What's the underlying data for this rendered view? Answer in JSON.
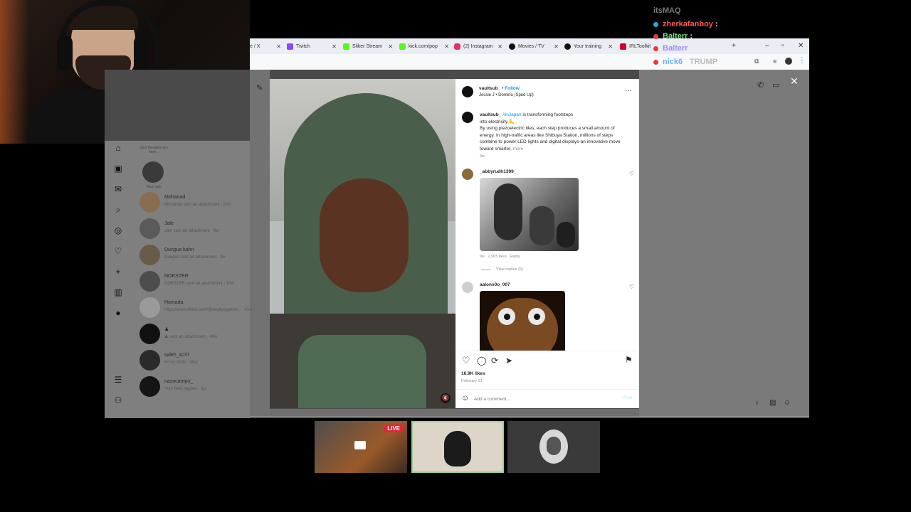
{
  "chat": [
    {
      "user": "itsMAQ",
      "color": "#7b7b7b"
    },
    {
      "user": "zherkafanboy",
      "color": "#ff5a5a"
    },
    {
      "user": "Balterr",
      "color": "#6fe07a"
    },
    {
      "user": "Balterr",
      "color": "#9d8cff"
    },
    {
      "user": "nick6",
      "color": "#6ab0ff",
      "message": "TRUMP"
    }
  ],
  "tabs": [
    {
      "label": "e / X",
      "icon_color": "#000000"
    },
    {
      "label": "Twitch",
      "icon_color": "#9146ff"
    },
    {
      "label": "Sliker Stream",
      "icon_color": "#53fc18"
    },
    {
      "label": "kick.com/pop",
      "icon_color": "#53fc18"
    },
    {
      "label": "(2) Instagram",
      "icon_color": "#e1306c"
    },
    {
      "label": "Movies / TV",
      "icon_color": "#111111"
    },
    {
      "label": "Your training",
      "icon_color": "#111111"
    },
    {
      "label": "IRLToolkit",
      "icon_color": "#d00030"
    }
  ],
  "window_controls": {
    "new_tab": "+",
    "minimize": "–",
    "maximize": "▫",
    "close": "✕"
  },
  "sidebar": {
    "nav_icons": [
      "home-icon",
      "reels-icon",
      "messages-icon",
      "search-icon",
      "explore-icon",
      "notifications-icon",
      "create-icon",
      "dashboard-icon",
      "profile-icon",
      "menu-icon",
      "more-icon"
    ],
    "your_note": {
      "title": "Your thoughts are here...",
      "label": "Your note"
    },
    "dms": [
      {
        "name": "Mohanad",
        "sub": "Mohanad sent an attachment · 20h"
      },
      {
        "name": "Jale",
        "sub": "Jale sent an attachment · 9w"
      },
      {
        "name": "Dungus kahn",
        "sub": "Dungus sent an attachment · 9w"
      },
      {
        "name": "NOKSTER",
        "sub": "NOKSTER sent an attachment · 10w"
      },
      {
        "name": "Hamada",
        "sub": "https://www.tiktok.com/@soullysgamer... · 41w"
      },
      {
        "name": "♟",
        "sub": "♟ sent an attachment · 46w"
      },
      {
        "name": "saleh_sc37",
        "sub": "Hi my bride · 48w"
      },
      {
        "name": "nazocampo_",
        "sub": "Your best regions · 1y"
      }
    ]
  },
  "post": {
    "username": "vaultsub_",
    "follow": "Follow",
    "audio": "Jessie J • Domino (Sped Up)",
    "caption_tag": "#inJapan",
    "caption_line1": "is transforming footsteps",
    "caption_line2": "into electricity 🦶",
    "caption_body": "By using piezoelectric tiles, each step produces a small amount of energy. In high-traffic areas like Shibuya Station, millions of steps combine to power LED lights and digital displays-an innovative move toward smarter,",
    "more": "more",
    "caption_time": "9w",
    "comments": [
      {
        "user": "_abbyrudh1399_",
        "time": "9w",
        "likes": "2,905 likes",
        "reply": "Reply",
        "view_replies": "View replies (5)"
      },
      {
        "user": "aalons0o_007"
      }
    ],
    "likes": "16.9K likes",
    "date": "February 21",
    "comment_placeholder": "Add a comment...",
    "post_button": "Post"
  },
  "thumbs": {
    "live": "LIVE"
  }
}
